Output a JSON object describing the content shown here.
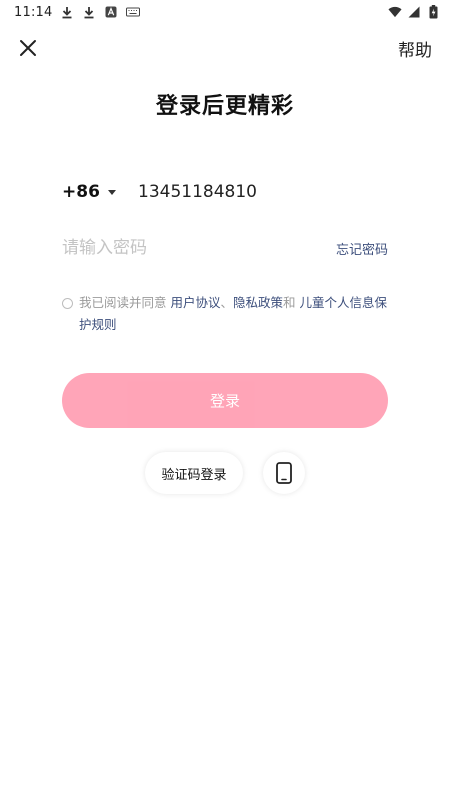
{
  "status_bar": {
    "time": "11:14",
    "icons_left": [
      "download-icon",
      "download-icon",
      "a-square-icon",
      "keyboard-icon"
    ],
    "icons_right": [
      "wifi-icon",
      "signal-icon",
      "battery-charging-icon"
    ]
  },
  "top_bar": {
    "close_icon": "close-icon",
    "help_label": "帮助"
  },
  "title": "登录后更精彩",
  "phone": {
    "country_code": "+86",
    "number": "13451184810"
  },
  "password": {
    "placeholder": "请输入密码",
    "forgot_label": "忘记密码"
  },
  "agreement": {
    "prefix": "我已阅读并同意 ",
    "user_agreement": "用户协议",
    "separator": "、",
    "privacy_policy": "隐私政策",
    "and": "和 ",
    "children_rules": "儿童个人信息保护规则"
  },
  "login_button_label": "登录",
  "alt_login": {
    "code_login_label": "验证码登录",
    "phone_icon": "phone-icon"
  },
  "colors": {
    "accent": "#ffa0b4",
    "link": "#3d4f7c",
    "placeholder": "#c4c4c4"
  }
}
